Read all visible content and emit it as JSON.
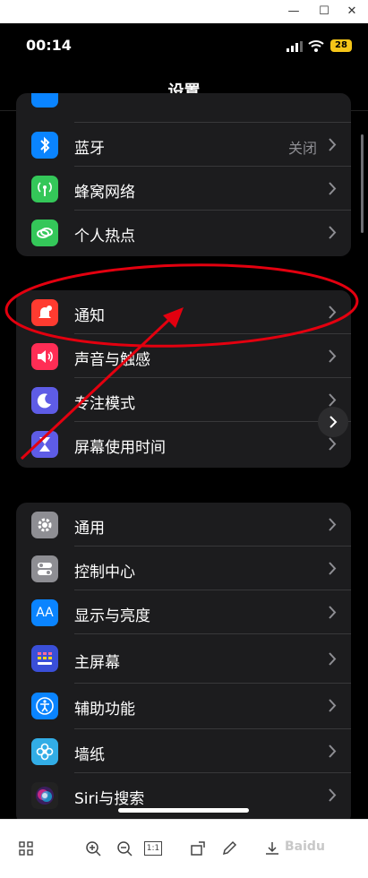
{
  "status": {
    "time": "00:14",
    "battery": "28"
  },
  "nav": {
    "title": "设置"
  },
  "group1": [
    {
      "label": "蓝牙",
      "value": "关闭",
      "icon": "bluetooth-icon",
      "color": "#0a84ff"
    },
    {
      "label": "蜂窝网络",
      "value": "",
      "icon": "cellular-icon",
      "color": "#34c759"
    },
    {
      "label": "个人热点",
      "value": "",
      "icon": "hotspot-icon",
      "color": "#34c759"
    }
  ],
  "group2": [
    {
      "label": "通知",
      "icon": "notification-bell-icon",
      "color": "#ff3b30"
    },
    {
      "label": "声音与触感",
      "icon": "speaker-icon",
      "color": "#ff2d55"
    },
    {
      "label": "专注模式",
      "icon": "moon-icon",
      "color": "#5e5ce6"
    },
    {
      "label": "屏幕使用时间",
      "icon": "hourglass-icon",
      "color": "#5e5ce6"
    }
  ],
  "group3": [
    {
      "label": "通用",
      "icon": "gear-icon",
      "color": "#8e8e93"
    },
    {
      "label": "控制中心",
      "icon": "toggles-icon",
      "color": "#8e8e93"
    },
    {
      "label": "显示与亮度",
      "icon": "text-size-icon",
      "color": "#0a84ff"
    },
    {
      "label": "主屏幕",
      "icon": "grid-icon",
      "color": "#3a4fd8"
    },
    {
      "label": "辅助功能",
      "icon": "accessibility-icon",
      "color": "#0a84ff"
    },
    {
      "label": "墙纸",
      "icon": "flower-icon",
      "color": "#32ade6"
    },
    {
      "label": "Siri与搜索",
      "icon": "siri-icon",
      "color": "#222222"
    }
  ],
  "toolbar": {
    "zoom_ratio": "1:1"
  },
  "annotation": {
    "color": "#e3000f"
  },
  "watermark": "Baidu"
}
